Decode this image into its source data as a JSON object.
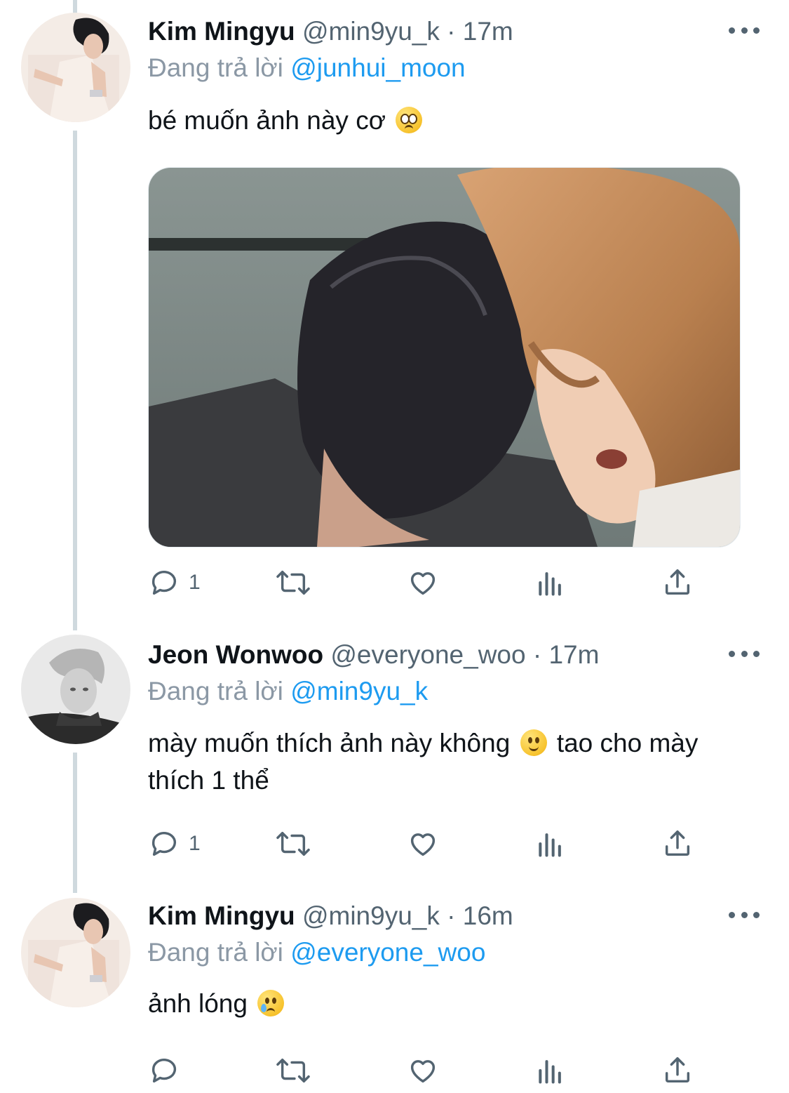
{
  "colors": {
    "accent": "#1d9bf0",
    "text": "#0f1419",
    "muted": "#536471",
    "thread_line": "#cfd9de"
  },
  "tweets": [
    {
      "name": "Kim Mingyu",
      "handle": "@min9yu_k",
      "sep": "·",
      "time": "17m",
      "reply_prefix": "Đang trả lời",
      "reply_to": "@junhui_moon",
      "text": "bé muốn ảnh này cơ",
      "emoji": "pleading-face-emoji",
      "has_media": true,
      "reply_count": "1"
    },
    {
      "name": "Jeon Wonwoo",
      "handle": "@everyone_woo",
      "sep": "·",
      "time": "17m",
      "reply_prefix": "Đang trả lời",
      "reply_to": "@min9yu_k",
      "text_part1": "mày muốn thích ảnh này không",
      "emoji": "slightly-smiling-face-emoji",
      "text_part2": "tao cho mày",
      "text_line2": "thích 1 thể",
      "reply_count": "1"
    },
    {
      "name": "Kim Mingyu",
      "handle": "@min9yu_k",
      "sep": "·",
      "time": "16m",
      "reply_prefix": "Đang trả lời",
      "reply_to": "@everyone_woo",
      "text": "ảnh lóng",
      "emoji": "crying-face-emoji",
      "reply_count": ""
    }
  ],
  "icons": [
    "reply-icon",
    "retweet-icon",
    "like-icon",
    "analytics-icon",
    "share-icon",
    "more-icon"
  ]
}
